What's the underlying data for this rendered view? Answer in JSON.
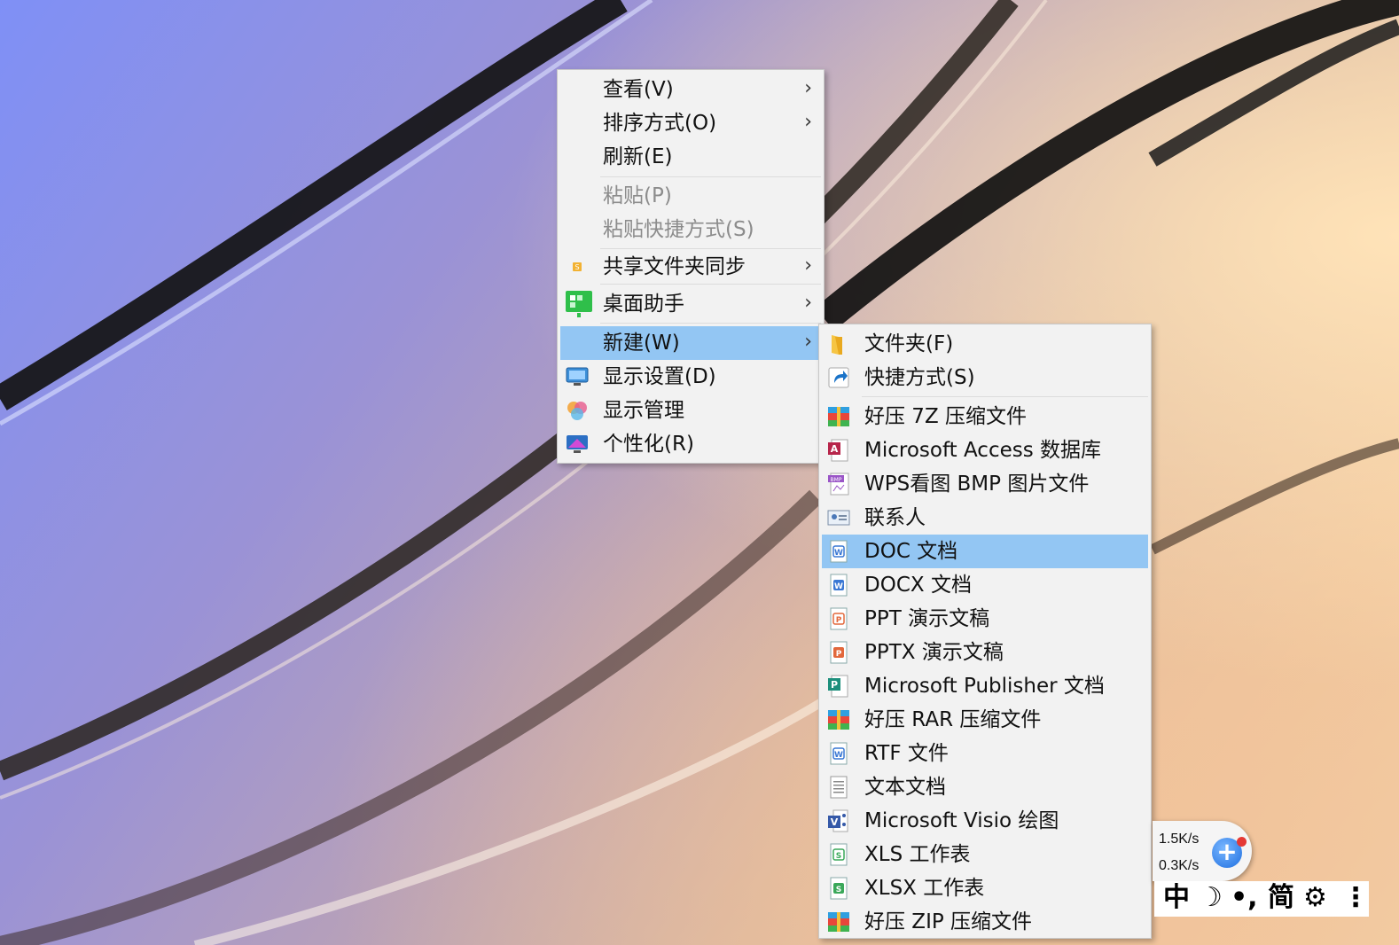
{
  "context_menu": {
    "items": [
      {
        "label": "查看(V)"
      },
      {
        "label": "排序方式(O)"
      },
      {
        "label": "刷新(E)"
      },
      {
        "label": "粘贴(P)"
      },
      {
        "label": "粘贴快捷方式(S)"
      },
      {
        "label": "共享文件夹同步",
        "icon": "share-sync-icon"
      },
      {
        "label": "桌面助手",
        "icon": "desktop-assistant-icon"
      },
      {
        "label": "新建(W)"
      },
      {
        "label": "显示设置(D)",
        "icon": "display-settings-icon"
      },
      {
        "label": "显示管理",
        "icon": "display-manage-icon"
      },
      {
        "label": "个性化(R)",
        "icon": "personalize-icon"
      }
    ]
  },
  "new_submenu": {
    "items": [
      {
        "label": "文件夹(F)",
        "icon": "folder-icon"
      },
      {
        "label": "快捷方式(S)",
        "icon": "shortcut-icon"
      },
      {
        "label": "好压 7Z 压缩文件",
        "icon": "haozip-icon"
      },
      {
        "label": "Microsoft Access 数据库",
        "icon": "access-icon"
      },
      {
        "label": "WPS看图 BMP 图片文件",
        "icon": "bmp-icon"
      },
      {
        "label": "联系人",
        "icon": "contact-icon"
      },
      {
        "label": "DOC 文档",
        "icon": "doc-icon"
      },
      {
        "label": "DOCX 文档",
        "icon": "docx-icon"
      },
      {
        "label": "PPT 演示文稿",
        "icon": "ppt-icon"
      },
      {
        "label": "PPTX 演示文稿",
        "icon": "pptx-icon"
      },
      {
        "label": "Microsoft Publisher 文档",
        "icon": "publisher-icon"
      },
      {
        "label": "好压 RAR 压缩文件",
        "icon": "haozip-icon"
      },
      {
        "label": "RTF 文件",
        "icon": "rtf-icon"
      },
      {
        "label": "文本文档",
        "icon": "text-doc-icon"
      },
      {
        "label": "Microsoft Visio 绘图",
        "icon": "visio-icon"
      },
      {
        "label": "XLS 工作表",
        "icon": "xls-icon"
      },
      {
        "label": "XLSX 工作表",
        "icon": "xlsx-icon"
      },
      {
        "label": "好压 ZIP 压缩文件",
        "icon": "haozip-icon"
      }
    ]
  },
  "network_widget": {
    "upload": "1.5K/s",
    "download": "0.3K/s"
  },
  "ime_bar": {
    "mode": "中",
    "moon": "☽",
    "punct": "•,",
    "charset": "简",
    "settings": "⚙",
    "more": "⋮"
  },
  "colors": {
    "highlight": "#93c6f3",
    "menu_bg": "#f2f2f2",
    "disabled_text": "#8c8c8c"
  }
}
